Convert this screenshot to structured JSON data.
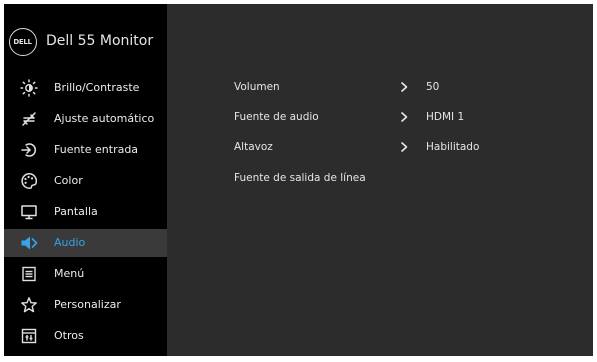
{
  "header": {
    "logo_text": "DELL",
    "title": "Dell 55 Monitor"
  },
  "sidebar": {
    "items": [
      {
        "label": "Brillo/Contraste",
        "icon": "brightness-icon",
        "active": false
      },
      {
        "label": "Ajuste  automático",
        "icon": "auto-adjust-icon",
        "active": false
      },
      {
        "label": "Fuente entrada",
        "icon": "input-source-icon",
        "active": false
      },
      {
        "label": "Color",
        "icon": "color-palette-icon",
        "active": false
      },
      {
        "label": "Pantalla",
        "icon": "display-icon",
        "active": false
      },
      {
        "label": "Audio",
        "icon": "speaker-icon",
        "active": true
      },
      {
        "label": "Menú",
        "icon": "menu-icon",
        "active": false
      },
      {
        "label": "Personalizar",
        "icon": "star-icon",
        "active": false
      },
      {
        "label": "Otros",
        "icon": "others-icon",
        "active": false
      }
    ]
  },
  "main": {
    "rows": [
      {
        "label": "Volumen",
        "value": "50",
        "has_chevron": true
      },
      {
        "label": "Fuente de audio",
        "value": "HDMI 1",
        "has_chevron": true
      },
      {
        "label": "Altavoz",
        "value": "Habilitado",
        "has_chevron": true
      },
      {
        "label": "Fuente de salida de línea",
        "value": "",
        "has_chevron": false
      }
    ]
  },
  "colors": {
    "accent": "#36a3ea",
    "sidebar_bg": "#000000",
    "panel_bg": "#2c2c2c",
    "active_bg": "#3a3a3a",
    "text": "#e6e6e6"
  }
}
